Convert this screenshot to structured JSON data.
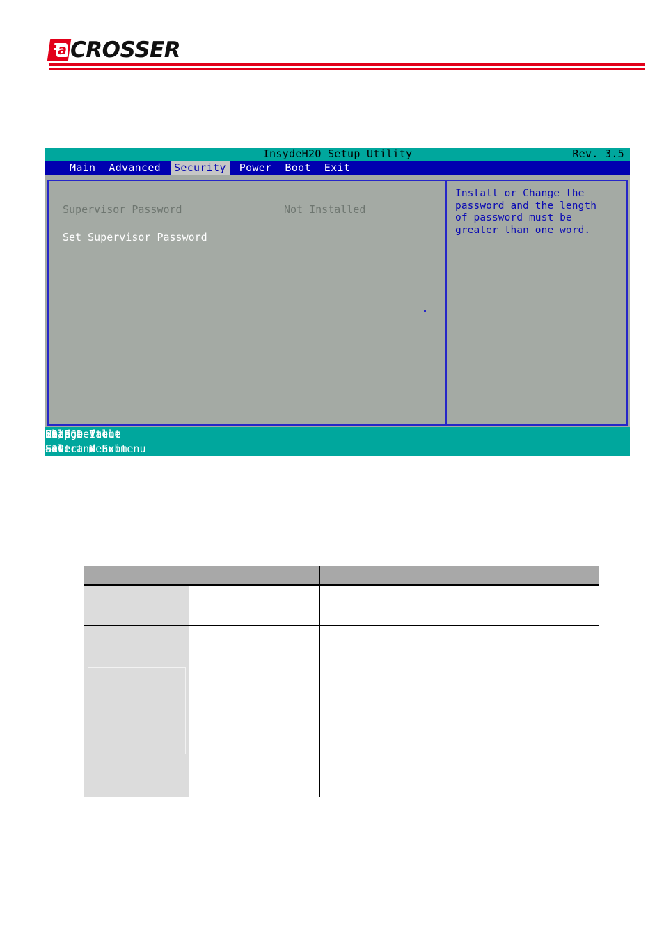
{
  "header": {
    "brand_mark": "E",
    "brand_letter": "a",
    "brand_word": "CROSSER",
    "accent_color": "#e2001a"
  },
  "bios": {
    "title": "InsydeH2O Setup Utility",
    "revision": "Rev. 3.5",
    "title_bg": "#00a79d",
    "menubar_bg": "#0000b0",
    "panel_bg": "#a4aaa4",
    "border_color": "#2626c8",
    "menu": [
      {
        "label": "Main",
        "selected": false
      },
      {
        "label": "Advanced",
        "selected": false
      },
      {
        "label": "Security",
        "selected": true
      },
      {
        "label": "Power",
        "selected": false
      },
      {
        "label": "Boot",
        "selected": false
      },
      {
        "label": "Exit",
        "selected": false
      }
    ],
    "settings": [
      {
        "label": "Supervisor Password",
        "value": "Not Installed",
        "state": "dimmed"
      },
      {
        "label": "Set Supervisor Password",
        "value": "",
        "state": "normal"
      }
    ],
    "help": "Install or Change the\npassword and the length\nof password must be\ngreater than one word.",
    "help_color": "#0a0ab4",
    "status_rows": [
      [
        {
          "key": "F1",
          "label": "Help"
        },
        {
          "key": "↑↓",
          "label": "Select Item"
        },
        {
          "key": "F5/F6",
          "label": "Change Value"
        },
        {
          "key": "F9",
          "label": "Load Default"
        }
      ],
      [
        {
          "key": "Esc",
          "label": "Exit"
        },
        {
          "key": "↔",
          "label": "Select Menu"
        },
        {
          "key": "Enter",
          "label": "Select ▶ Submenu"
        },
        {
          "key": "F10",
          "label": "Save and Exit"
        }
      ]
    ]
  },
  "spec_table": {
    "header_bg": "#a8a8a8",
    "label_col_bg": "#dcdcdc",
    "columns": [
      "",
      "",
      ""
    ],
    "rows": [
      {
        "label": "",
        "middle": "",
        "description": ""
      },
      {
        "label": "",
        "middle": "",
        "description": ""
      }
    ]
  }
}
